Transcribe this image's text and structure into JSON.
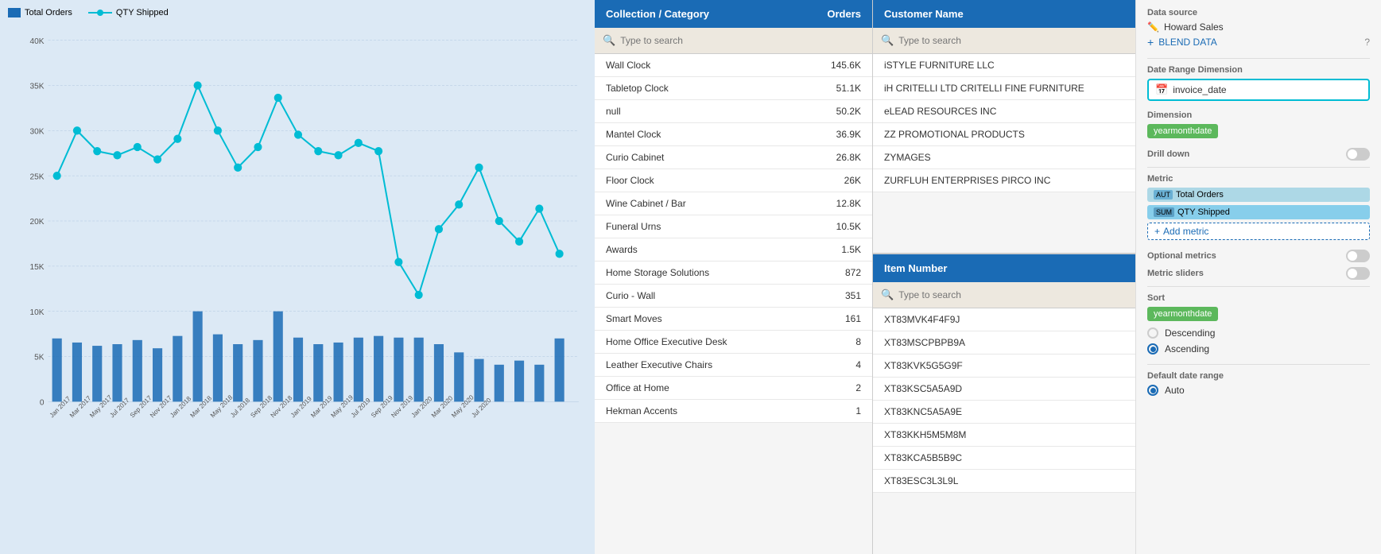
{
  "legend": {
    "totalOrders": "Total Orders",
    "qtyShipped": "QTY Shipped"
  },
  "collection_filter": {
    "header": {
      "title": "Collection / Category",
      "orders_label": "Orders"
    },
    "search_placeholder": "Type to search",
    "items": [
      {
        "name": "Wall Clock",
        "value": "145.6K"
      },
      {
        "name": "Tabletop Clock",
        "value": "51.1K"
      },
      {
        "name": "null",
        "value": "50.2K"
      },
      {
        "name": "Mantel Clock",
        "value": "36.9K"
      },
      {
        "name": "Curio Cabinet",
        "value": "26.8K"
      },
      {
        "name": "Floor Clock",
        "value": "26K"
      },
      {
        "name": "Wine Cabinet / Bar",
        "value": "12.8K"
      },
      {
        "name": "Funeral Urns",
        "value": "10.5K"
      },
      {
        "name": "Awards",
        "value": "1.5K"
      },
      {
        "name": "Home Storage Solutions",
        "value": "872"
      },
      {
        "name": "Curio - Wall",
        "value": "351"
      },
      {
        "name": "Smart Moves",
        "value": "161"
      },
      {
        "name": "Home Office Executive Desk",
        "value": "8"
      },
      {
        "name": "Leather Executive Chairs",
        "value": "4"
      },
      {
        "name": "Office at Home",
        "value": "2"
      },
      {
        "name": "Hekman Accents",
        "value": "1"
      }
    ]
  },
  "customer_filter": {
    "header": {
      "title": "Customer Name"
    },
    "search_placeholder": "Type to search",
    "items": [
      "iSTYLE FURNITURE LLC",
      "iH CRITELLI LTD CRITELLI FINE FURNITURE",
      "eLEAD RESOURCES INC",
      "ZZ PROMOTIONAL PRODUCTS",
      "ZYMAGES",
      "ZURFLUH ENTERPRISES PIRCO INC"
    ]
  },
  "item_filter": {
    "header": {
      "title": "Item Number"
    },
    "search_placeholder": "Type to search",
    "items": [
      "XT83MVK4F4F9J",
      "XT83MSCPBPB9A",
      "XT83KVK5G5G9F",
      "XT83KSC5A5A9D",
      "XT83KNC5A5A9E",
      "XT83KKH5M5M8M",
      "XT83KCA5B5B9C",
      "XT83ESC3L3L9L"
    ]
  },
  "settings": {
    "data_source_label": "Data source",
    "data_source_name": "Howard Sales",
    "blend_data_label": "BLEND DATA",
    "date_range_label": "Date Range Dimension",
    "date_range_value": "invoice_date",
    "dimension_label": "Dimension",
    "dimension_value": "yearmonthdate",
    "drill_down_label": "Drill down",
    "metric_label": "Metric",
    "total_orders_label": "Total Orders",
    "qty_shipped_label": "QTY Shipped",
    "add_metric_label": "Add metric",
    "optional_metrics_label": "Optional metrics",
    "metric_sliders_label": "Metric sliders",
    "sort_label": "Sort",
    "sort_dim_value": "yearmonthdate",
    "descending_label": "Descending",
    "ascending_label": "Ascending",
    "default_date_range_label": "Default date range",
    "auto_label": "Auto",
    "aut_badge": "AUT",
    "sum_badge": "SUM"
  },
  "chart": {
    "y_labels": [
      "40K",
      "35K",
      "30K",
      "25K",
      "20K",
      "15K",
      "10K",
      "5K",
      "0"
    ],
    "x_labels": [
      "Jan 2017",
      "Mar 2017",
      "May 2017",
      "Jul 2017",
      "Sep 2017",
      "Nov 2017",
      "Jan 2018",
      "Mar 2018",
      "May 2018",
      "Jul 2018",
      "Sep 2018",
      "Nov 2018",
      "Jan 2019",
      "Mar 2019",
      "May 2019",
      "Jul 2019",
      "Sep 2019",
      "Nov 2019",
      "Jan 2020",
      "Mar 2020",
      "May 2020",
      "Jul 2020"
    ]
  }
}
